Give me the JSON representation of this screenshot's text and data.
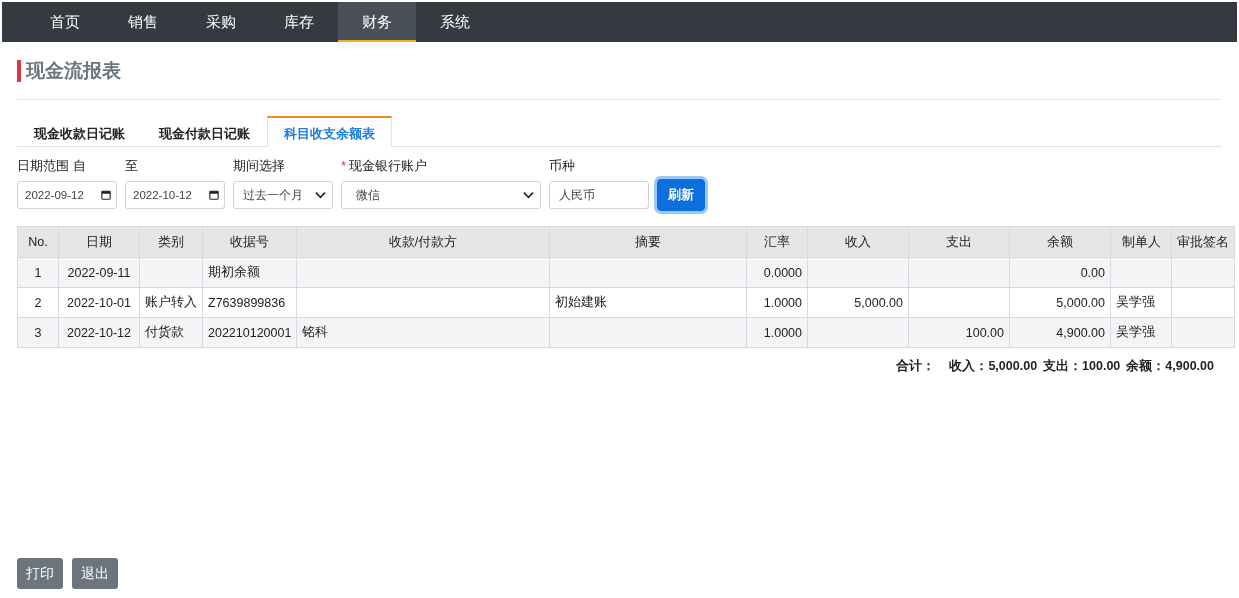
{
  "nav": [
    {
      "label": "首页",
      "selected": false
    },
    {
      "label": "销售",
      "selected": false
    },
    {
      "label": "采购",
      "selected": false
    },
    {
      "label": "库存",
      "selected": false
    },
    {
      "label": "财务",
      "selected": true
    },
    {
      "label": "系统",
      "selected": false
    }
  ],
  "page_title": "现金流报表",
  "tabs": [
    {
      "label": "现金收款日记账",
      "selected": false
    },
    {
      "label": "现金付款日记账",
      "selected": false
    },
    {
      "label": "科目收支余额表",
      "selected": true
    }
  ],
  "filters": [
    {
      "kind": "date",
      "label": "日期范围 自",
      "value": "2022-09-12",
      "required": false
    },
    {
      "kind": "date",
      "label": "至",
      "value": "2022-10-12",
      "required": false
    },
    {
      "kind": "select",
      "label": "期间选择",
      "value": "过去一个月",
      "required": false
    },
    {
      "kind": "select",
      "label": "现金银行账户",
      "value": "微信",
      "required": true
    },
    {
      "kind": "text",
      "label": "币种",
      "value": "人民币",
      "required": false
    }
  ],
  "required_mark": "*",
  "refresh_button": "刷新",
  "table": {
    "columns": [
      "No.",
      "日期",
      "类别",
      "收据号",
      "收款/付款方",
      "摘要",
      "汇率",
      "收入",
      "支出",
      "余额",
      "制单人",
      "审批签名"
    ],
    "rows": [
      [
        "1",
        "2022-09-11",
        "",
        "期初余额",
        "",
        "",
        "0.0000",
        "",
        "",
        "0.00",
        "",
        ""
      ],
      [
        "2",
        "2022-10-01",
        "账户转入",
        "Z7639899836",
        "",
        "初始建账",
        "1.0000",
        "5,000.00",
        "",
        "5,000.00",
        "吴学强",
        ""
      ],
      [
        "3",
        "2022-10-12",
        "付货款",
        "202210120001",
        "铭科",
        "",
        "1.0000",
        "",
        "100.00",
        "4,900.00",
        "吴学强",
        ""
      ]
    ]
  },
  "totals": {
    "label": "合计：",
    "items": [
      "收入：**5,000.00**",
      "支出：**100.00**",
      "余额：**4,900.00**"
    ]
  },
  "footer_buttons": [
    "打印",
    "退出"
  ]
}
